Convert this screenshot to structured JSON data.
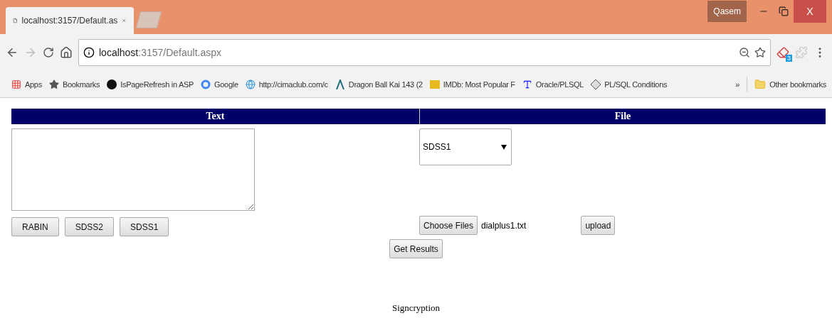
{
  "browser": {
    "tabs": [
      {
        "title": "localhost:3157/Default.as",
        "selected": true
      }
    ],
    "profile": "Qasem",
    "close_label": "X",
    "address": {
      "host": "localhost",
      "rest": ":3157/Default.aspx"
    },
    "extension_badge": "3",
    "bookmarks": [
      {
        "kind": "apps",
        "label": "Apps"
      },
      {
        "kind": "star",
        "label": "Bookmarks"
      },
      {
        "kind": "dark",
        "label": "IsPageRefresh in ASP"
      },
      {
        "kind": "google",
        "label": "Google"
      },
      {
        "kind": "globe",
        "label": "http://cimaclub.com/c"
      },
      {
        "kind": "logo",
        "label": "Dragon Ball Kai 143 (2"
      },
      {
        "kind": "imdb",
        "label": "IMDb: Most Popular F"
      },
      {
        "kind": "type",
        "label": "Oracle/PLSQL"
      },
      {
        "kind": "diamond",
        "label": "PL/SQL Conditions"
      }
    ],
    "overflow": "»",
    "other_bookmarks": "Other bookmarks"
  },
  "page": {
    "columns": [
      {
        "heading": "Text"
      },
      {
        "heading": "File"
      }
    ],
    "text_buttons": [
      "RABIN",
      "SDSS2",
      "SDSS1"
    ],
    "algorithm_select": {
      "value": "SDSS1"
    },
    "file_button": "Choose Files",
    "file_name": "dialplus1.txt",
    "upload_button": "upload",
    "results_button": "Get Results",
    "footer": "Signcryption"
  }
}
